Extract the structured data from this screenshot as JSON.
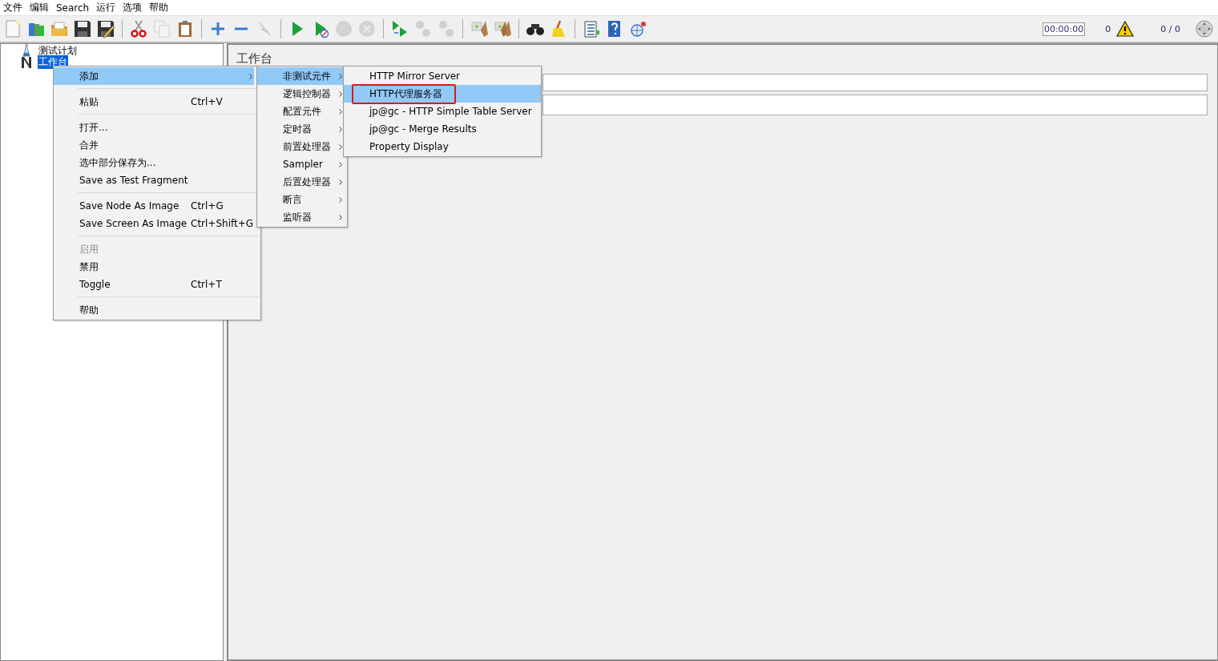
{
  "menu_bar": [
    {
      "label": "文件"
    },
    {
      "label": "编辑"
    },
    {
      "label": "Search"
    },
    {
      "label": "运行"
    },
    {
      "label": "选项"
    },
    {
      "label": "帮助"
    }
  ],
  "toolbar": [
    [
      {
        "kind": "new",
        "disabled": false
      },
      {
        "kind": "templates",
        "disabled": false
      },
      {
        "kind": "open",
        "disabled": false
      },
      {
        "kind": "save",
        "disabled": false
      },
      {
        "kind": "save-as",
        "disabled": false
      }
    ],
    [
      {
        "kind": "cut",
        "disabled": false
      },
      {
        "kind": "copy",
        "disabled": true
      },
      {
        "kind": "paste",
        "disabled": false
      }
    ],
    [
      {
        "kind": "expand",
        "disabled": false
      },
      {
        "kind": "collapse",
        "disabled": false
      },
      {
        "kind": "toggle",
        "disabled": true
      }
    ],
    [
      {
        "kind": "start",
        "disabled": false
      },
      {
        "kind": "start-no-pause",
        "disabled": false
      },
      {
        "kind": "stop",
        "disabled": true
      },
      {
        "kind": "shutdown",
        "disabled": true
      }
    ],
    [
      {
        "kind": "remote-start",
        "disabled": false
      },
      {
        "kind": "remote-stop",
        "disabled": true
      },
      {
        "kind": "remote-exit",
        "disabled": true
      }
    ],
    [
      {
        "kind": "clear",
        "disabled": false
      },
      {
        "kind": "clear-all",
        "disabled": false
      }
    ],
    [
      {
        "kind": "search",
        "disabled": false
      },
      {
        "kind": "reset-search",
        "disabled": false
      }
    ],
    [
      {
        "kind": "functions",
        "disabled": false
      },
      {
        "kind": "help",
        "disabled": false
      },
      {
        "kind": "log",
        "disabled": false
      }
    ]
  ],
  "status": {
    "timer": "00:00:00",
    "warning_count": "0",
    "threads": "0 / 0"
  },
  "tree": [
    {
      "label": "测试计划",
      "selected": false
    },
    {
      "label": "工作台",
      "selected": true
    }
  ],
  "panel": {
    "title": "工作台"
  },
  "context_menu": [
    {
      "kind": "item",
      "label": "添加",
      "submenu": true,
      "selected": true,
      "disabled": false
    },
    {
      "kind": "separator"
    },
    {
      "kind": "item",
      "label": "粘贴",
      "shortcut": "Ctrl+V",
      "submenu": false,
      "selected": false,
      "disabled": false
    },
    {
      "kind": "separator"
    },
    {
      "kind": "item",
      "label": "打开...",
      "submenu": false,
      "selected": false,
      "disabled": false
    },
    {
      "kind": "item",
      "label": "合并",
      "submenu": false,
      "selected": false,
      "disabled": false
    },
    {
      "kind": "item",
      "label": "选中部分保存为...",
      "submenu": false,
      "selected": false,
      "disabled": false
    },
    {
      "kind": "item",
      "label": "Save as Test Fragment",
      "submenu": false,
      "selected": false,
      "disabled": false
    },
    {
      "kind": "separator"
    },
    {
      "kind": "item",
      "label": "Save Node As Image",
      "shortcut": "Ctrl+G",
      "submenu": false,
      "selected": false,
      "disabled": false
    },
    {
      "kind": "item",
      "label": "Save Screen As Image",
      "shortcut": "Ctrl+Shift+G",
      "submenu": false,
      "selected": false,
      "disabled": false
    },
    {
      "kind": "separator"
    },
    {
      "kind": "item",
      "label": "启用",
      "submenu": false,
      "selected": false,
      "disabled": true
    },
    {
      "kind": "item",
      "label": "禁用",
      "submenu": false,
      "selected": false,
      "disabled": false
    },
    {
      "kind": "item",
      "label": "Toggle",
      "shortcut": "Ctrl+T",
      "submenu": false,
      "selected": false,
      "disabled": false
    },
    {
      "kind": "separator"
    },
    {
      "kind": "item",
      "label": "帮助",
      "submenu": false,
      "selected": false,
      "disabled": false
    }
  ],
  "add_submenu": [
    {
      "label": "非测试元件",
      "selected": true
    },
    {
      "label": "逻辑控制器",
      "selected": false
    },
    {
      "label": "配置元件",
      "selected": false
    },
    {
      "label": "定时器",
      "selected": false
    },
    {
      "label": "前置处理器",
      "selected": false
    },
    {
      "label": "Sampler",
      "selected": false
    },
    {
      "label": "后置处理器",
      "selected": false
    },
    {
      "label": "断言",
      "selected": false
    },
    {
      "label": "监听器",
      "selected": false
    }
  ],
  "non_test_submenu": [
    {
      "label": "HTTP Mirror Server",
      "selected": false,
      "outlined": false
    },
    {
      "label": "HTTP代理服务器",
      "selected": true,
      "outlined": true
    },
    {
      "label": "jp@gc - HTTP Simple Table Server",
      "selected": false,
      "outlined": false
    },
    {
      "label": "jp@gc - Merge Results",
      "selected": false,
      "outlined": false
    },
    {
      "label": "Property Display",
      "selected": false,
      "outlined": false
    }
  ]
}
